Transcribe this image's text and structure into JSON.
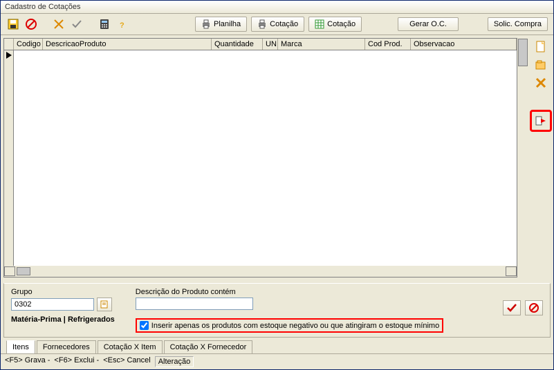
{
  "window": {
    "title": "Cadastro de Cotações"
  },
  "toolbar": {
    "planilha": "Planilha",
    "cotacao1": "Cotação",
    "cotacao2": "Cotação",
    "gerar_oc": "Gerar O.C.",
    "solic_compra": "Solic. Compra"
  },
  "grid": {
    "headers": {
      "codigo": "Codigo",
      "desc": "DescricaoProduto",
      "qtd": "Quantidade",
      "un": "UN",
      "marca": "Marca",
      "codprod": "Cod Prod.",
      "obs": "Observacao"
    }
  },
  "filter": {
    "grupo_label": "Grupo",
    "grupo_value": "0302",
    "grupo_desc": "Matéria-Prima  |  Refrigerados",
    "desc_label": "Descrição do Produto contém",
    "desc_value": "",
    "checkbox_label": "Inserir apenas os produtos com estoque negativo ou que atingiram o estoque mínimo"
  },
  "tabs": {
    "itens": "Itens",
    "fornecedores": "Fornecedores",
    "cot_item": "Cotação X Item",
    "cot_forn": "Cotação X Fornecedor"
  },
  "status": {
    "grava": "<F5>  Grava   -",
    "exclui": "<F6>  Exclui   -",
    "cancel": "<Esc>  Cancel",
    "mode": "Alteração"
  }
}
